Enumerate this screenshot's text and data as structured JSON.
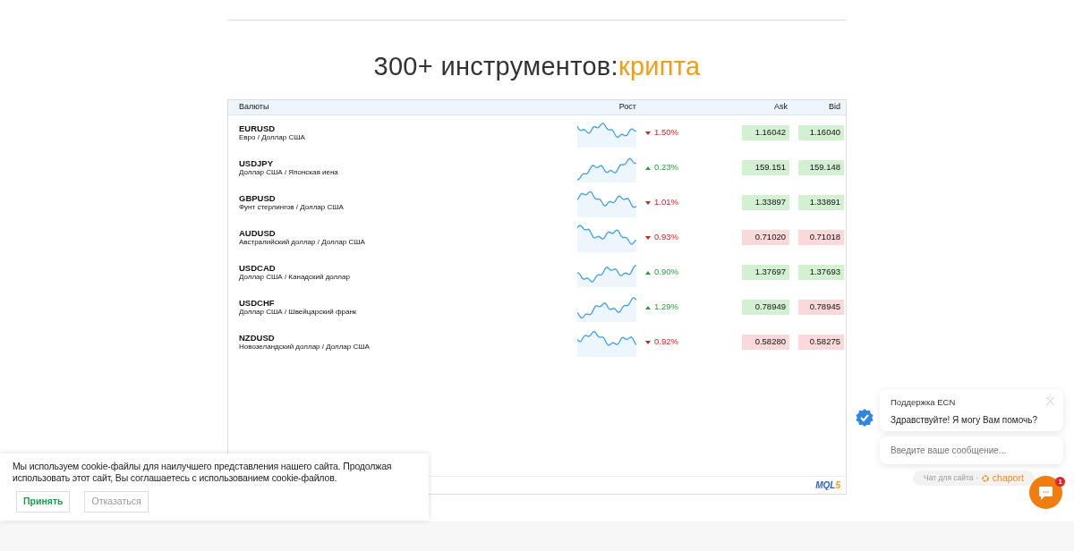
{
  "heading": {
    "text": "300+ инструментов:",
    "accent": "крипта"
  },
  "table": {
    "columns": [
      "Валюты",
      "Рост",
      "Ask",
      "Bid"
    ],
    "rows": [
      {
        "symbol": "EURUSD",
        "description": "Евро / Доллар США",
        "rising": false,
        "change": "1.50%",
        "ask": "1.16042",
        "ask_rising": true,
        "bid": "1.16040",
        "bid_rising": true
      },
      {
        "symbol": "USDJPY",
        "description": "Доллар США / Японская иена",
        "rising": true,
        "change": "0.23%",
        "ask": "159.151",
        "ask_rising": true,
        "bid": "159.148",
        "bid_rising": true
      },
      {
        "symbol": "GBPUSD",
        "description": "Фунт стерлингов / Доллар США",
        "rising": false,
        "change": "1.01%",
        "ask": "1.33897",
        "ask_rising": true,
        "bid": "1.33891",
        "bid_rising": true
      },
      {
        "symbol": "AUDUSD",
        "description": "Австралийский доллар / Доллар США",
        "rising": false,
        "change": "0.93%",
        "ask": "0.71020",
        "ask_rising": false,
        "bid": "0.71018",
        "bid_rising": false
      },
      {
        "symbol": "USDCAD",
        "description": "Доллар США / Канадский доллар",
        "rising": true,
        "change": "0.90%",
        "ask": "1.37697",
        "ask_rising": true,
        "bid": "1.37693",
        "bid_rising": true
      },
      {
        "symbol": "USDCHF",
        "description": "Доллар США / Швейцарский франк",
        "rising": true,
        "change": "1.29%",
        "ask": "0.78949",
        "ask_rising": true,
        "bid": "0.78945",
        "bid_rising": false
      },
      {
        "symbol": "NZDUSD",
        "description": "Новозеландский доллар / Доллар США",
        "rising": false,
        "change": "0.92%",
        "ask": "0.58280",
        "ask_rising": false,
        "bid": "0.58275",
        "bid_rising": false
      }
    ],
    "logo": {
      "main": "MQL",
      "accent": "5"
    }
  },
  "cookie_banner": {
    "text": "Мы используем cookie-файлы для наилучшего представления нашего сайта. Продолжая использовать этот сайт, Вы соглашаетесь с использованием cookie-файлов.",
    "accept": "Принять",
    "decline": "Отказаться"
  },
  "chat": {
    "agent": "Поддержка ECN",
    "message": "Здравствуйте! Я могу Вам помочь?",
    "placeholder": "Введите ваше сообщение...",
    "powered_by": "Чат для сайта ·",
    "brand": "chaport",
    "unread": "1"
  }
}
